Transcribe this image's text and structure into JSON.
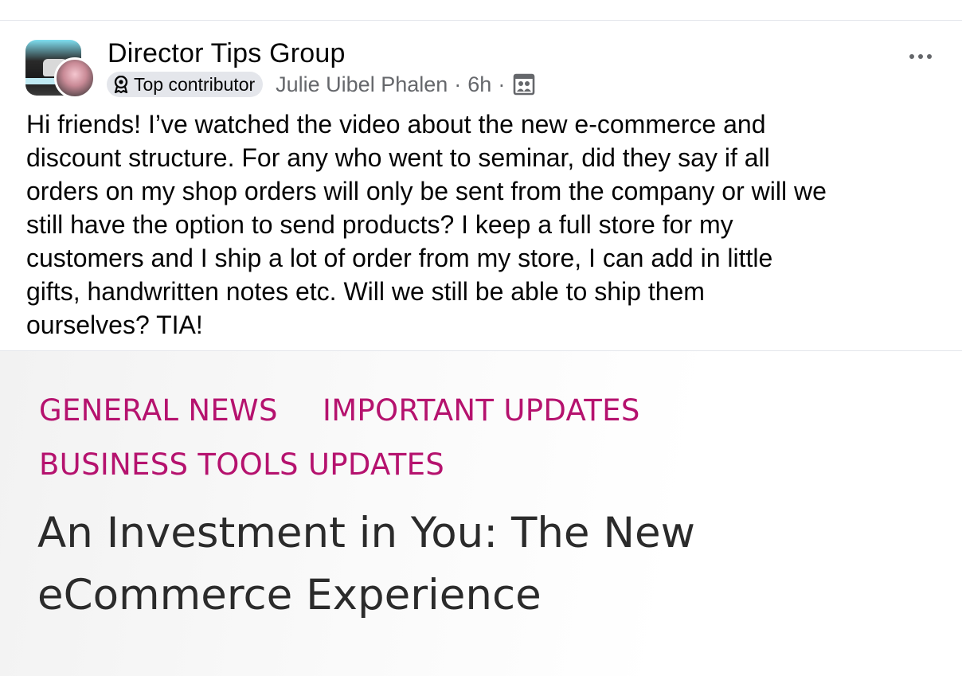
{
  "post": {
    "group_name": "Director Tips Group",
    "badge_label": "Top contributor",
    "author": "Julie Uibel Phalen",
    "separator": "·",
    "time": "6h",
    "text_lines": [
      "Hi friends! I’ve watched the video about the new e-commerce and",
      "discount structure. For any who went to seminar, did they say if all",
      "orders on my shop orders will only be sent from the company or will we",
      "still have the option to send products? I keep a full store for my",
      "customers and I ship a lot of order from my store, I can add in little",
      "gifts, handwritten notes etc. Will we still be able to ship them",
      "ourselves? TIA!"
    ]
  },
  "icons": {
    "more": "more-horizontal-icon",
    "badge": "top-contributor-badge-icon",
    "privacy": "members-only-group-icon"
  },
  "attachment": {
    "categories": [
      "GENERAL NEWS",
      "IMPORTANT UPDATES",
      "BUSINESS TOOLS UPDATES"
    ],
    "title_lines": [
      "An Investment in You: The New",
      "eCommerce Experience"
    ]
  },
  "colors": {
    "category": "#b5126e",
    "meta": "#65676b",
    "badge_bg": "#e4e6eb"
  }
}
